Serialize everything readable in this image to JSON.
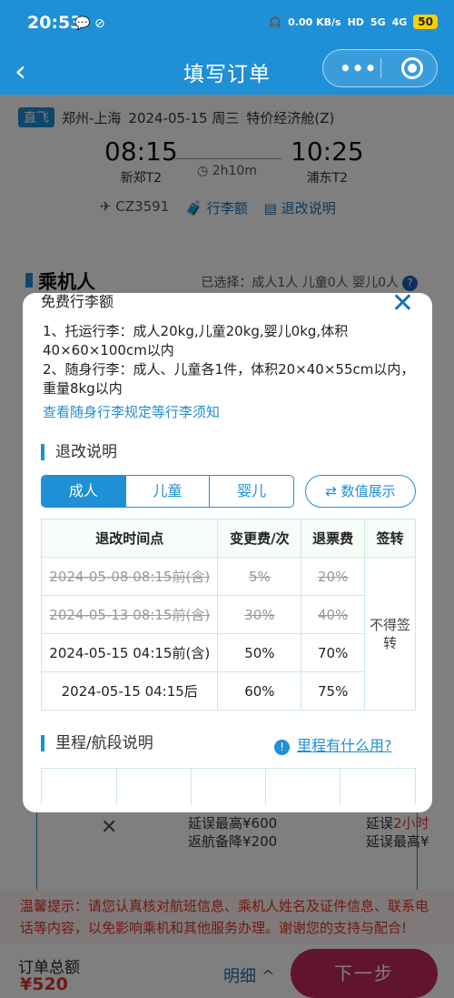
{
  "status_bar": {
    "time": "20:53",
    "net_speed": "0.00 KB/s",
    "network": "5G",
    "network2": "4G",
    "battery": "50",
    "hd": "HD"
  },
  "nav": {
    "title": "填写订单",
    "back_icon": "chevron-left-icon",
    "more_label": "•••"
  },
  "flight": {
    "tag": "直飞",
    "route": "郑州-上海",
    "date": "2024-05-15 周三",
    "cabin": "特价经济舱(Z)",
    "depart_time": "08:15",
    "depart_airport": "新郑T2",
    "arrive_time": "10:25",
    "arrive_airport": "浦东T2",
    "duration": "2h10m",
    "flight_no": "CZ3591",
    "baggage_link": "行李额",
    "refund_link": "退改说明"
  },
  "passengers": {
    "heading": "乘机人",
    "selected": "已选择：成人1人 儿童0人 婴儿0人"
  },
  "insurance": {
    "left_mark": "✕",
    "mid_line1": "延误最高¥600",
    "mid_line2": "返航备降¥200",
    "right_line1a": "延误",
    "right_line1b": "2小时",
    "right_line2": "延误最高¥"
  },
  "notice": "温馨提示：请您认真核对航班信息、乘机人姓名及证件信息、联系电话等内容，以免影响乘机和其他服务办理。谢谢您的支持与配合!",
  "bottom": {
    "total_label": "订单总额",
    "total": "¥520",
    "detail": "明细 ^",
    "next": "下一步"
  },
  "modal": {
    "partial_title": "免费行李额",
    "baggage_rule1": "1、托运行李：成人20kg,儿童20kg,婴儿0kg,体积40×60×100cm以内",
    "baggage_rule2": "2、随身行李：成人、儿童各1件，体积20×40×55cm以内，重量8kg以内",
    "baggage_link": "查看随身行李规定等行李须知",
    "refund_title": "退改说明",
    "tabs": [
      "成人",
      "儿童",
      "婴儿"
    ],
    "numeric_btn": "⇄ 数值展示",
    "table_headers": [
      "退改时间点",
      "变更费/次",
      "退票费",
      "签转"
    ],
    "table_rows": [
      {
        "time": "2024-05-08 08:15前(含)",
        "change": "5%",
        "refund": "20%"
      },
      {
        "time": "2024-05-13 08:15前(含)",
        "change": "30%",
        "refund": "40%"
      },
      {
        "time": "2024-05-15 04:15前(含)",
        "change": "50%",
        "refund": "70%"
      },
      {
        "time": "2024-05-15 04:15后",
        "change": "60%",
        "refund": "75%"
      }
    ],
    "sign_transfer": "不得签转",
    "mileage_title": "里程/航段说明",
    "mileage_link": "里程有什么用?"
  },
  "colors": {
    "brand_blue": "#1f8fd6",
    "price_red": "#e0322a",
    "next_button": "#c22a5a"
  }
}
